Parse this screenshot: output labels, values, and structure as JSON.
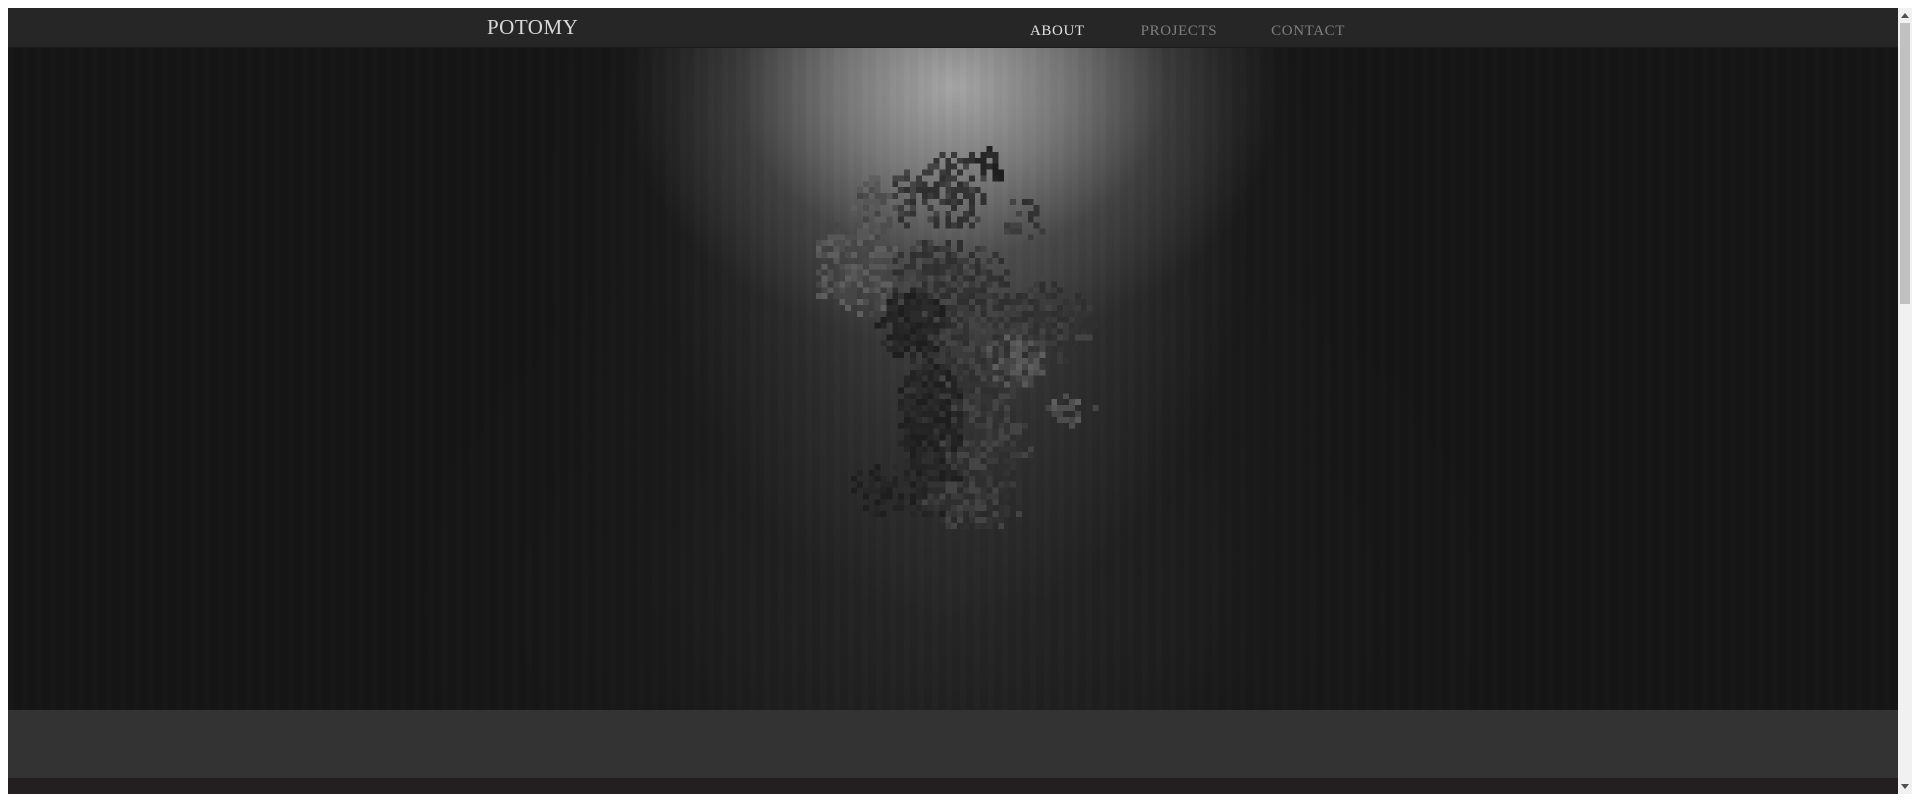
{
  "header": {
    "brand": "POTOMY",
    "nav": [
      {
        "label": "ABOUT",
        "active": true
      },
      {
        "label": "PROJECTS",
        "active": false
      },
      {
        "label": "CONTACT",
        "active": false
      }
    ]
  },
  "hero": {
    "image": "pixel-art-creature",
    "icon": "pixel-creature-icon"
  },
  "scrollbar": {
    "position": 0
  },
  "colors": {
    "page_background": "#141414",
    "navbar": "#262626",
    "nav_active": "#e2e2e2",
    "nav_inactive": "#7f7f7f",
    "footer_band": "#333333",
    "footer_edge": "#231e20"
  }
}
